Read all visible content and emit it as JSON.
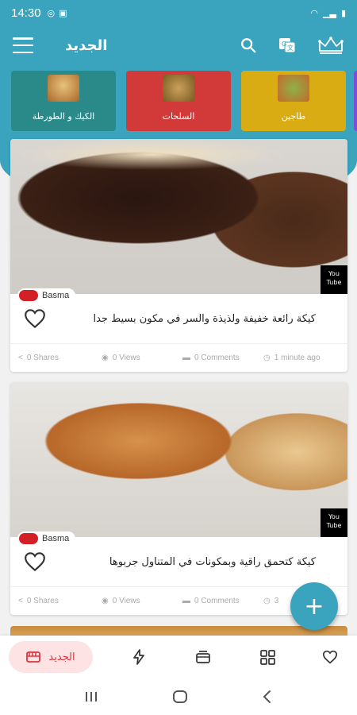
{
  "status_bar": {
    "time": "14:30"
  },
  "app_bar": {
    "title": "الجديد"
  },
  "categories": [
    {
      "label": "الكيك و الطورطة",
      "color": "#2a8a8a"
    },
    {
      "label": "السلحات",
      "color": "#d23a3a"
    },
    {
      "label": "طاجين",
      "color": "#d8ac12"
    }
  ],
  "posts": [
    {
      "author": "Basma",
      "title": "كيكة رائعة خفيفة ولذيذة والسر في مكون بسيط جدا",
      "shares": "0 Shares",
      "views": "0 Views",
      "comments": "0 Comments",
      "time": "1 minute ago",
      "video_badge": "You Tube"
    },
    {
      "author": "Basma",
      "title": "كيكة كتحمق راقية وبمكونات في المتناول جربوها",
      "shares": "0 Shares",
      "views": "0 Views",
      "comments": "0 Comments",
      "time": "3",
      "video_badge": "You Tube"
    }
  ],
  "fab": {
    "label": "+"
  },
  "bottom_nav": {
    "active_label": "الجديد"
  },
  "colors": {
    "primary": "#3aa3bd",
    "active": "#e0343c",
    "active_bg": "#fde3e4"
  }
}
